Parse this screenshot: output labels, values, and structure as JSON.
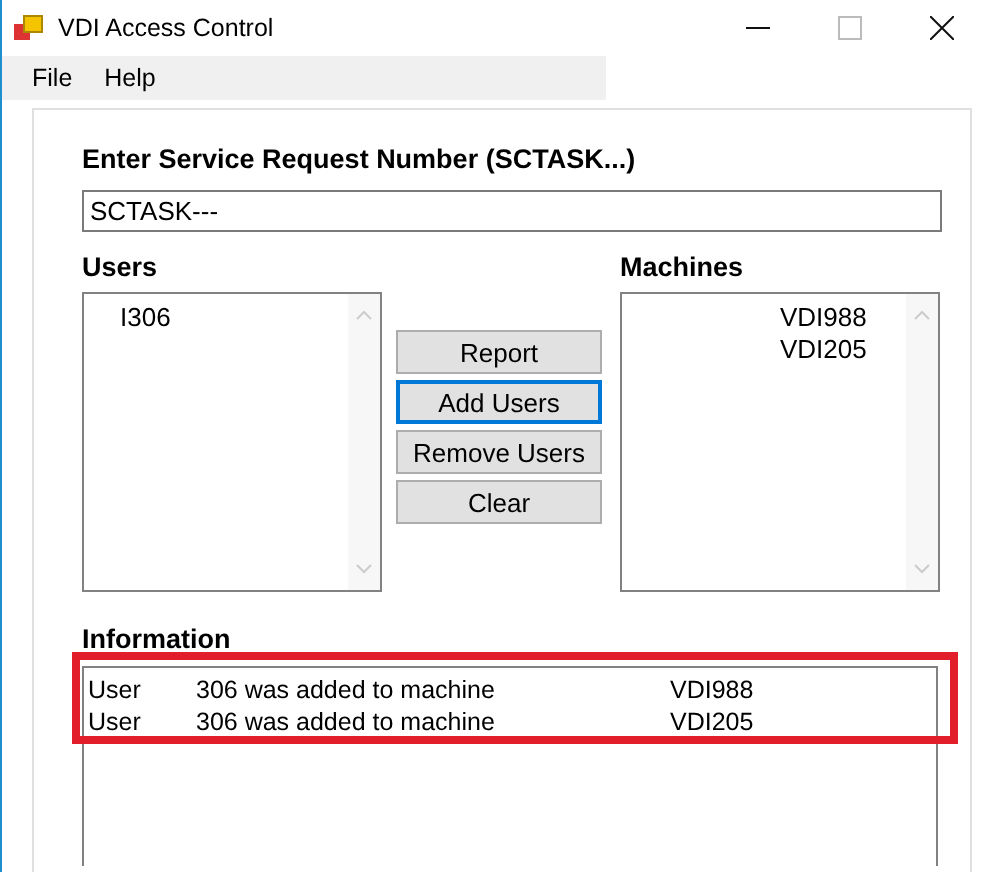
{
  "window": {
    "title": "VDI Access Control"
  },
  "menu": [
    "File",
    "Help"
  ],
  "request": {
    "label": "Enter Service Request Number (SCTASK...)",
    "value": "SCTASK---"
  },
  "users": {
    "label": "Users",
    "items": [
      "I306"
    ]
  },
  "machines": {
    "label": "Machines",
    "items": [
      "VDI988",
      "VDI205"
    ]
  },
  "buttons": [
    {
      "label": "Report",
      "focused": false
    },
    {
      "label": "Add Users",
      "focused": true
    },
    {
      "label": "Remove Users",
      "focused": false
    },
    {
      "label": "Clear",
      "focused": false
    }
  ],
  "information": {
    "label": "Information",
    "highlighted": true,
    "lines": [
      {
        "column_1": "User",
        "column_2": "306 was added to machine",
        "column_3": "VDI988"
      },
      {
        "column_1": "User",
        "column_2": "306 was added to machine",
        "column_3": "VDI205"
      }
    ]
  }
}
